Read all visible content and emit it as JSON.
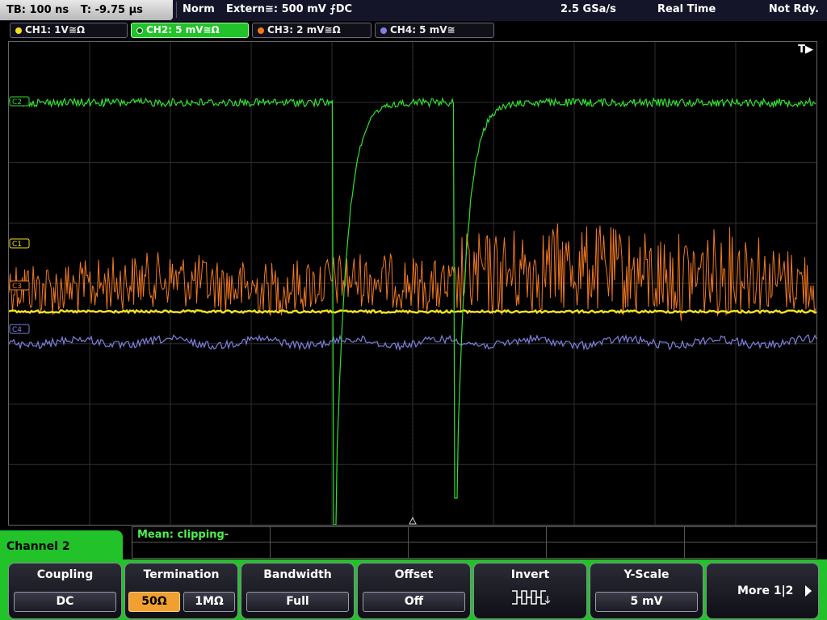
{
  "status": {
    "timebase": "TB: 100 ns",
    "trigger_time": "T: -9.75 µs",
    "mode": "Norm",
    "trigger": "Extern≅: 500 mV ⨍DC",
    "sample_rate": "2.5 GSa/s",
    "acquisition": "Real Time",
    "ready_state": "Not Rdy."
  },
  "channels": [
    {
      "label": "CH1: 1V≅Ω",
      "color": "#f0e020",
      "active": false
    },
    {
      "label": "CH2: 5 mV≅Ω",
      "color": "#30e030",
      "active": true
    },
    {
      "label": "CH3: 2 mV≅Ω",
      "color": "#f07820",
      "active": false
    },
    {
      "label": "CH4: 5 mV≅",
      "color": "#8080e0",
      "active": false
    }
  ],
  "screen": {
    "trigger_marker": "T▶",
    "ch2_marker": "C2",
    "ch1_marker": "C1",
    "ch3_marker": "C3",
    "ch4_marker": "C4"
  },
  "measurement": {
    "label": "Mean: clipping-"
  },
  "menu": {
    "title": "Channel 2",
    "coupling": {
      "title": "Coupling",
      "value": "DC"
    },
    "termination": {
      "title": "Termination",
      "options": [
        "50Ω",
        "1MΩ"
      ],
      "selected": "50Ω"
    },
    "bandwidth": {
      "title": "Bandwidth",
      "value": "Full"
    },
    "offset": {
      "title": "Offset",
      "value": "Off"
    },
    "invert": {
      "title": "Invert",
      "icon": "invert-waveform-icon"
    },
    "yscale": {
      "title": "Y-Scale",
      "value": "5 mV"
    },
    "more": {
      "label": "More 1|2",
      "icon": "arrow-right-icon"
    }
  }
}
